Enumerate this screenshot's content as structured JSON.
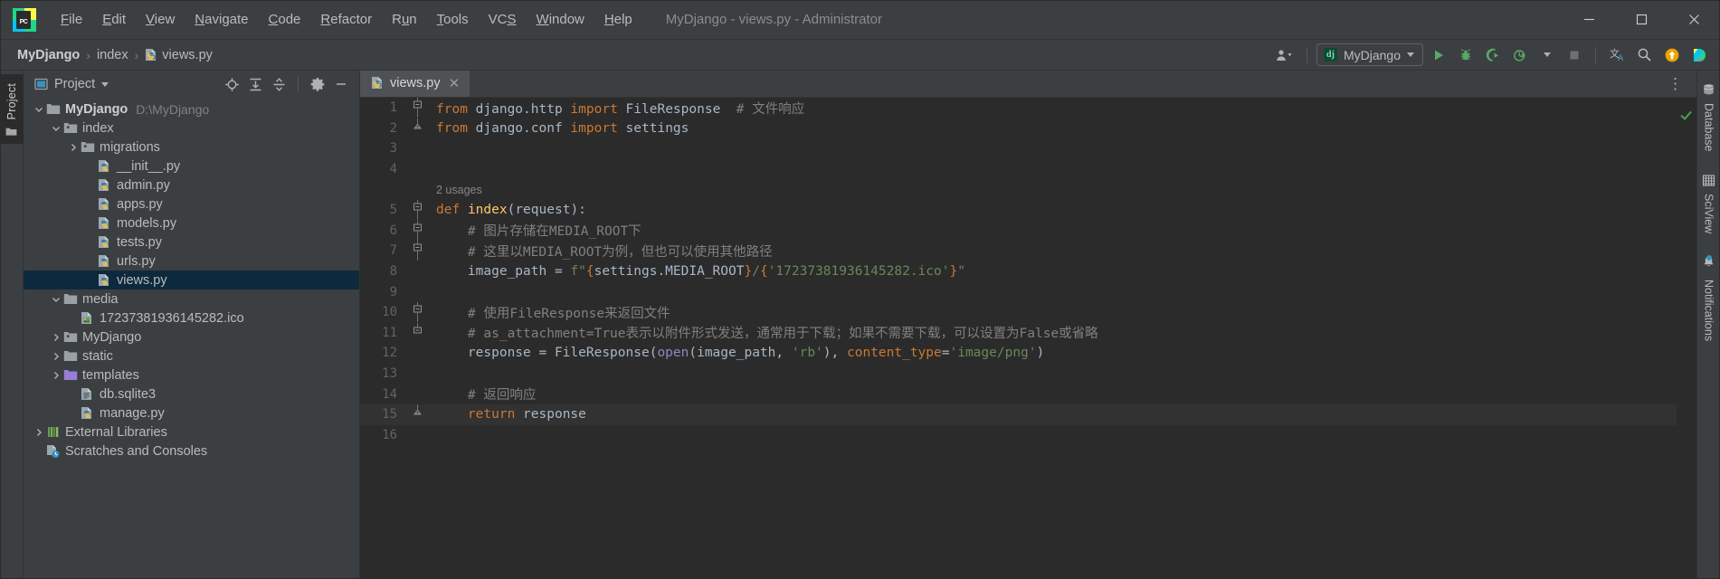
{
  "window": {
    "title": "MyDjango - views.py - Administrator",
    "logo_icon": "pycharm-logo-icon",
    "minimize_label": "Minimize",
    "maximize_label": "Maximize",
    "close_label": "Close"
  },
  "menubar": {
    "items": [
      {
        "label": "File",
        "mnemonic": "F"
      },
      {
        "label": "Edit",
        "mnemonic": "E"
      },
      {
        "label": "View",
        "mnemonic": "V"
      },
      {
        "label": "Navigate",
        "mnemonic": "N"
      },
      {
        "label": "Code",
        "mnemonic": "C"
      },
      {
        "label": "Refactor",
        "mnemonic": "R"
      },
      {
        "label": "Run",
        "mnemonic": "u"
      },
      {
        "label": "Tools",
        "mnemonic": "T"
      },
      {
        "label": "VCS",
        "mnemonic": "S"
      },
      {
        "label": "Window",
        "mnemonic": "W"
      },
      {
        "label": "Help",
        "mnemonic": "H"
      }
    ]
  },
  "navbar": {
    "breadcrumbs": [
      {
        "label": "MyDjango",
        "icon": "",
        "bold": true
      },
      {
        "label": "index",
        "icon": "",
        "bold": false
      },
      {
        "label": "views.py",
        "icon": "python-file-icon",
        "bold": false
      }
    ],
    "separator": "›",
    "account_icon": "user-account-icon",
    "run_config": {
      "name": "MyDjango",
      "badge": "dj"
    },
    "buttons": [
      {
        "name": "run-button",
        "icon": "run-icon",
        "tooltip": "Run"
      },
      {
        "name": "debug-button",
        "icon": "debug-bug-icon",
        "tooltip": "Debug"
      },
      {
        "name": "run-coverage-button",
        "icon": "coverage-icon",
        "tooltip": "Run with Coverage"
      },
      {
        "name": "profile-button",
        "icon": "profiler-icon",
        "tooltip": "Profile"
      },
      {
        "name": "stop-button",
        "icon": "stop-square-icon",
        "tooltip": "Stop"
      },
      {
        "name": "translate-button",
        "icon": "translate-icon",
        "tooltip": "Translate"
      },
      {
        "name": "search-everywhere-button",
        "icon": "search-icon",
        "tooltip": "Search Everywhere"
      },
      {
        "name": "update-project-button",
        "icon": "update-arrow-icon",
        "tooltip": "Update Project"
      },
      {
        "name": "ide-feature-button",
        "icon": "colorful-shield-icon",
        "tooltip": "Feature Trainer"
      }
    ]
  },
  "left_rail": {
    "tabs": [
      {
        "label": "Project",
        "icon": "project-folder-icon"
      }
    ]
  },
  "project_panel": {
    "title": "Project",
    "dropdown_icon": "chevron-down-icon",
    "header_buttons": [
      {
        "name": "select-opened-file-button",
        "icon": "locate-target-icon"
      },
      {
        "name": "expand-all-button",
        "icon": "expand-all-icon"
      },
      {
        "name": "collapse-all-button",
        "icon": "collapse-all-icon"
      },
      {
        "name": "panel-settings-button",
        "icon": "gear-icon"
      },
      {
        "name": "hide-panel-button",
        "icon": "minimize-icon"
      }
    ],
    "tree": [
      {
        "label": "MyDjango",
        "path": "D:\\MyDjango",
        "icon": "folder-icon",
        "twist": "down",
        "indent": 0,
        "bold": true,
        "selected": false
      },
      {
        "label": "index",
        "path": "",
        "icon": "module-folder-icon",
        "twist": "down",
        "indent": 1,
        "bold": false,
        "selected": false
      },
      {
        "label": "migrations",
        "path": "",
        "icon": "module-folder-icon",
        "twist": "right",
        "indent": 2,
        "bold": false,
        "selected": false
      },
      {
        "label": "__init__.py",
        "path": "",
        "icon": "python-file-icon",
        "twist": "none",
        "indent": 3,
        "bold": false,
        "selected": false
      },
      {
        "label": "admin.py",
        "path": "",
        "icon": "python-file-icon",
        "twist": "none",
        "indent": 3,
        "bold": false,
        "selected": false
      },
      {
        "label": "apps.py",
        "path": "",
        "icon": "python-file-icon",
        "twist": "none",
        "indent": 3,
        "bold": false,
        "selected": false
      },
      {
        "label": "models.py",
        "path": "",
        "icon": "python-file-icon",
        "twist": "none",
        "indent": 3,
        "bold": false,
        "selected": false
      },
      {
        "label": "tests.py",
        "path": "",
        "icon": "python-file-icon",
        "twist": "none",
        "indent": 3,
        "bold": false,
        "selected": false
      },
      {
        "label": "urls.py",
        "path": "",
        "icon": "python-file-icon",
        "twist": "none",
        "indent": 3,
        "bold": false,
        "selected": false
      },
      {
        "label": "views.py",
        "path": "",
        "icon": "python-file-icon",
        "twist": "none",
        "indent": 3,
        "bold": false,
        "selected": true
      },
      {
        "label": "media",
        "path": "",
        "icon": "folder-icon",
        "twist": "down",
        "indent": 1,
        "bold": false,
        "selected": false
      },
      {
        "label": "17237381936145282.ico",
        "path": "",
        "icon": "image-file-icon",
        "twist": "none",
        "indent": 2,
        "bold": false,
        "selected": false
      },
      {
        "label": "MyDjango",
        "path": "",
        "icon": "module-folder-icon",
        "twist": "right",
        "indent": 1,
        "bold": false,
        "selected": false
      },
      {
        "label": "static",
        "path": "",
        "icon": "folder-icon",
        "twist": "right",
        "indent": 1,
        "bold": false,
        "selected": false
      },
      {
        "label": "templates",
        "path": "",
        "icon": "templates-folder-icon",
        "twist": "right",
        "indent": 1,
        "bold": false,
        "selected": false
      },
      {
        "label": "db.sqlite3",
        "path": "",
        "icon": "db-file-icon",
        "twist": "none",
        "indent": 2,
        "bold": false,
        "selected": false
      },
      {
        "label": "manage.py",
        "path": "",
        "icon": "python-file-icon",
        "twist": "none",
        "indent": 2,
        "bold": false,
        "selected": false
      },
      {
        "label": "External Libraries",
        "path": "",
        "icon": "libraries-icon",
        "twist": "right",
        "indent": 0,
        "bold": false,
        "selected": false
      },
      {
        "label": "Scratches and Consoles",
        "path": "",
        "icon": "scratches-icon",
        "twist": "none",
        "indent": 0,
        "bold": false,
        "selected": false
      }
    ]
  },
  "editor": {
    "tabs": [
      {
        "label": "views.py",
        "icon": "python-file-icon",
        "active": true,
        "close_icon": "close-icon"
      }
    ],
    "options_icon": "more-options-icon",
    "inspection_status_icon": "green-check-icon",
    "inlay_hint_line": 5,
    "inlay_hint_text": "2 usages",
    "lines": [
      {
        "n": "1",
        "fold": "fold-start",
        "caret": false,
        "tokens": [
          {
            "t": "from",
            "c": "kw"
          },
          {
            "t": " django.http ",
            "c": "id"
          },
          {
            "t": "import",
            "c": "kw"
          },
          {
            "t": " FileResponse  ",
            "c": "id"
          },
          {
            "t": "# 文件响应",
            "c": "cmt"
          }
        ]
      },
      {
        "n": "2",
        "fold": "fold-end",
        "caret": false,
        "tokens": [
          {
            "t": "from",
            "c": "kw"
          },
          {
            "t": " django.conf ",
            "c": "id"
          },
          {
            "t": "import",
            "c": "kw"
          },
          {
            "t": " settings",
            "c": "id"
          }
        ]
      },
      {
        "n": "3",
        "fold": "",
        "caret": false,
        "tokens": []
      },
      {
        "n": "4",
        "fold": "",
        "caret": false,
        "tokens": []
      },
      {
        "n": "5",
        "fold": "fold-start",
        "caret": false,
        "tokens": [
          {
            "t": "def",
            "c": "kw"
          },
          {
            "t": " ",
            "c": "id"
          },
          {
            "t": "index",
            "c": "fn"
          },
          {
            "t": "(",
            "c": "id"
          },
          {
            "t": "request",
            "c": "id"
          },
          {
            "t": "):",
            "c": "id"
          }
        ]
      },
      {
        "n": "6",
        "fold": "fold-mid",
        "caret": false,
        "tokens": [
          {
            "t": "    # 图片存储在MEDIA_ROOT下",
            "c": "cmt"
          }
        ]
      },
      {
        "n": "7",
        "fold": "fold-mid",
        "caret": false,
        "tokens": [
          {
            "t": "    # 这里以MEDIA_ROOT为例，但也可以使用其他路径",
            "c": "cmt"
          }
        ]
      },
      {
        "n": "8",
        "fold": "",
        "caret": false,
        "tokens": [
          {
            "t": "    image_path = ",
            "c": "id"
          },
          {
            "t": "f\"",
            "c": "str"
          },
          {
            "t": "{",
            "c": "fb"
          },
          {
            "t": "settings.MEDIA_ROOT",
            "c": "id"
          },
          {
            "t": "}",
            "c": "fb"
          },
          {
            "t": "/",
            "c": "str"
          },
          {
            "t": "{",
            "c": "fb"
          },
          {
            "t": "'17237381936145282.ico'",
            "c": "str"
          },
          {
            "t": "}",
            "c": "fb"
          },
          {
            "t": "\"",
            "c": "str"
          }
        ]
      },
      {
        "n": "9",
        "fold": "",
        "caret": false,
        "tokens": []
      },
      {
        "n": "10",
        "fold": "fold-mid",
        "caret": false,
        "tokens": [
          {
            "t": "    # 使用FileResponse来返回文件",
            "c": "cmt"
          }
        ]
      },
      {
        "n": "11",
        "fold": "fold-end2",
        "caret": false,
        "tokens": [
          {
            "t": "    # as_attachment=True表示以附件形式发送，通常用于下载；如果不需要下载，可以设置为False或省略",
            "c": "cmt"
          }
        ]
      },
      {
        "n": "12",
        "fold": "",
        "caret": false,
        "tokens": [
          {
            "t": "    response = FileResponse(",
            "c": "id"
          },
          {
            "t": "open",
            "c": "bi"
          },
          {
            "t": "(image_path, ",
            "c": "id"
          },
          {
            "t": "'rb'",
            "c": "str"
          },
          {
            "t": "), ",
            "c": "id"
          },
          {
            "t": "content_type",
            "c": "param"
          },
          {
            "t": "=",
            "c": "id"
          },
          {
            "t": "'image/png'",
            "c": "str"
          },
          {
            "t": ")",
            "c": "id"
          }
        ]
      },
      {
        "n": "13",
        "fold": "",
        "caret": false,
        "tokens": []
      },
      {
        "n": "14",
        "fold": "",
        "caret": false,
        "tokens": [
          {
            "t": "    # 返回响应",
            "c": "cmt"
          }
        ]
      },
      {
        "n": "15",
        "fold": "fold-end",
        "caret": true,
        "tokens": [
          {
            "t": "    ",
            "c": "id"
          },
          {
            "t": "return",
            "c": "kw"
          },
          {
            "t": " response",
            "c": "id"
          }
        ]
      },
      {
        "n": "16",
        "fold": "",
        "caret": false,
        "tokens": []
      }
    ]
  },
  "right_rail": {
    "items": [
      {
        "label": "Database",
        "icon": "database-icon",
        "badge": false
      },
      {
        "label": "SciView",
        "icon": "sciview-grid-icon",
        "badge": false
      },
      {
        "label": "Notifications",
        "icon": "bell-icon",
        "badge": true
      }
    ]
  },
  "colors": {
    "accent_green": "#499c54",
    "keyword_orange": "#cc7832",
    "string_green": "#6a8759",
    "function_yellow": "#ffc66d",
    "comment_gray": "#808080",
    "builtin_purple": "#8888c6",
    "selection_blue": "#0d293e",
    "panel_bg": "#3c3f41",
    "editor_bg": "#2b2b2b"
  }
}
